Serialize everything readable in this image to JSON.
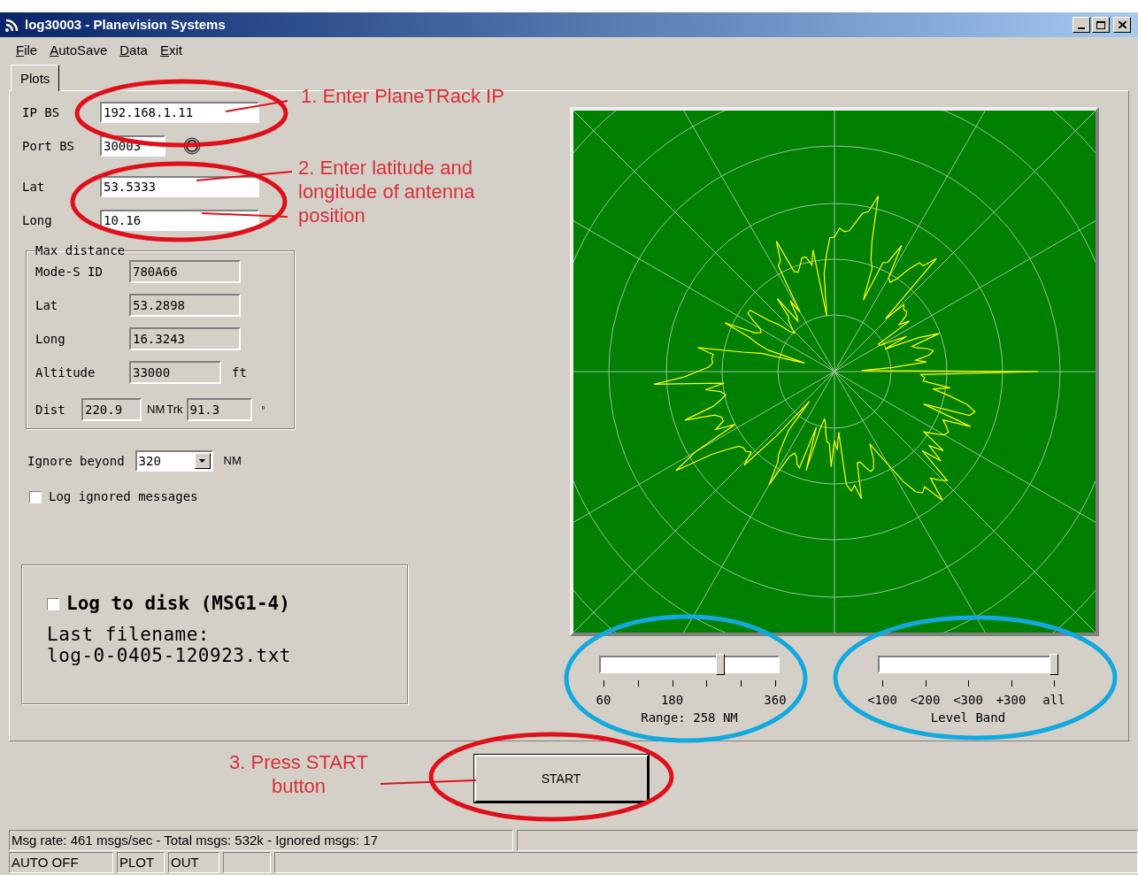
{
  "window": {
    "title": "log30003 - Planevision Systems"
  },
  "menu": [
    "File",
    "AutoSave",
    "Data",
    "Exit"
  ],
  "tabs": [
    {
      "label": "Plots",
      "selected": true
    }
  ],
  "connection": [
    {
      "label": "IP BS",
      "value": "192.168.1.11",
      "kind": "wide"
    },
    {
      "label": "Port BS",
      "value": "30003",
      "kind": "port"
    },
    {
      "label": "Lat",
      "value": "53.5333",
      "kind": "wide"
    },
    {
      "label": "Long",
      "value": "10.16",
      "kind": "wide"
    }
  ],
  "max_distance": {
    "title": "Max distance",
    "rows": [
      {
        "label": "Mode-S ID",
        "value": "780A66"
      },
      {
        "label": "Lat",
        "value": "53.2898"
      },
      {
        "label": "Long",
        "value": "16.3243"
      },
      {
        "label": "Altitude",
        "value": "33000",
        "unit": "ft"
      }
    ],
    "dist": {
      "label": "Dist",
      "value": "220.9",
      "unit": "NM"
    },
    "trk": {
      "label": "Trk",
      "value": "91.3",
      "unit": "°"
    }
  },
  "ignore": {
    "label": "Ignore beyond",
    "value": "320",
    "unit": "NM"
  },
  "log_ignored": {
    "label": "Log ignored messages",
    "checked": false
  },
  "log_to_disk": {
    "label": "Log to disk (MSG1-4)",
    "checked": false,
    "filename_label": "Last filename:",
    "filename": "log-0-0405-120923.txt"
  },
  "range_slider": {
    "ticks": [
      "60",
      "180",
      "360"
    ],
    "reading": "Range: 258 NM",
    "level": 0.68
  },
  "level_band": {
    "ticks": [
      "<100",
      "<200",
      "<300",
      "+300",
      "all"
    ],
    "label": "Level Band",
    "level": 1
  },
  "start_button": "START",
  "status_bar": {
    "message": "Msg rate: 461 msgs/sec - Total msgs: 532k - Ignored msgs: 17",
    "panels": [
      "AUTO OFF",
      "PLOT",
      "OUT"
    ]
  },
  "annotations": [
    {
      "text": "1. Enter PlaneTRack IP"
    },
    {
      "text": "2. Enter latitude and longitude of antenna position"
    },
    {
      "text": "3. Press START button"
    }
  ]
}
